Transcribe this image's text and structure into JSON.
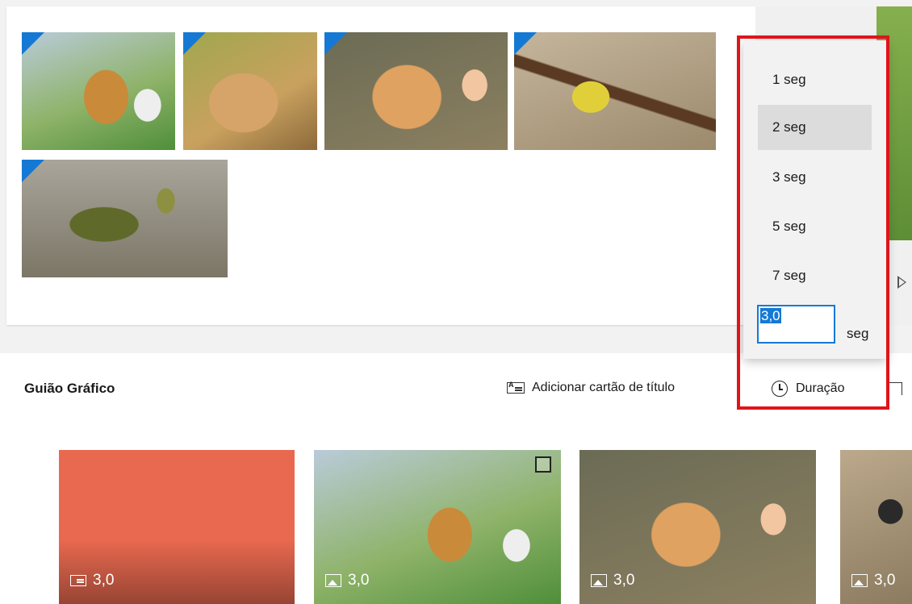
{
  "library": {
    "thumbnails": [
      {
        "subject": "dog-with-headphones"
      },
      {
        "subject": "rabbit"
      },
      {
        "subject": "kitten"
      },
      {
        "subject": "blue-tit-bird"
      },
      {
        "subject": "turtle"
      }
    ]
  },
  "storyboard": {
    "title": "Guião Gráfico",
    "add_title_card_label": "Adicionar cartão de título",
    "duration_label": "Duração",
    "cards": [
      {
        "type": "title-card",
        "color": "#e8694f",
        "duration": "3,0"
      },
      {
        "type": "photo",
        "subject": "dog-with-headphones",
        "duration": "3,0"
      },
      {
        "type": "photo",
        "subject": "kitten",
        "duration": "3,0"
      },
      {
        "type": "photo",
        "subject": "blue-tit-bird",
        "duration": "3,0"
      }
    ]
  },
  "duration_popup": {
    "options": [
      "1 seg",
      "2 seg",
      "3 seg",
      "5 seg",
      "7 seg"
    ],
    "selected_option": "2 seg",
    "custom_value": "3,0",
    "custom_unit": "seg"
  },
  "colors": {
    "accent": "#1479d4",
    "highlight_border": "#e0141a",
    "title_card": "#e8694f"
  }
}
